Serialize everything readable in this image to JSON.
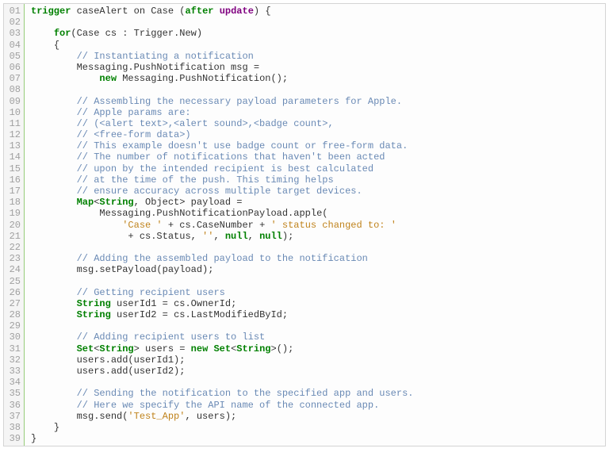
{
  "code": {
    "line_numbers": [
      "01",
      "02",
      "03",
      "04",
      "05",
      "06",
      "07",
      "08",
      "09",
      "10",
      "11",
      "12",
      "13",
      "14",
      "15",
      "16",
      "17",
      "18",
      "19",
      "20",
      "21",
      "22",
      "23",
      "24",
      "25",
      "26",
      "27",
      "28",
      "29",
      "30",
      "31",
      "32",
      "33",
      "34",
      "35",
      "36",
      "37",
      "38",
      "39"
    ],
    "tokens": {
      "trigger": "trigger",
      "for": "for",
      "new": "new",
      "after": "after",
      "update": "update",
      "null": "null",
      "Map": "Map",
      "String": "String",
      "Set": "Set"
    },
    "identifiers": {
      "caseAlert": "caseAlert",
      "on": "on",
      "Case": "Case",
      "cs": "cs",
      "Trigger_New": "Trigger.New",
      "Messaging_PushNotification": "Messaging.PushNotification",
      "msg": "msg",
      "Messaging_PushNotification_ctor": "Messaging.PushNotification();",
      "Object": "Object",
      "payload": "payload",
      "Messaging_PushNotificationPayload_apple": "Messaging.PushNotificationPayload.apple(",
      "cs_CaseNumber": "cs.CaseNumber",
      "cs_Status": "cs.Status",
      "msg_setPayload": "msg.setPayload(payload);",
      "userId1": "userId1",
      "userId2": "userId2",
      "cs_OwnerId": "cs.OwnerId;",
      "cs_LastModifiedById": "cs.LastModifiedById;",
      "users": "users",
      "users_add1": "users.add(userId1);",
      "users_add2": "users.add(userId2);",
      "msg_send": "msg.send("
    },
    "strings": {
      "case_prefix": "'Case '",
      "status_changed": "' status changed to: '",
      "empty": "''",
      "test_app": "'Test_App'"
    },
    "comments": {
      "c05": "// Instantiating a notification",
      "c09": "// Assembling the necessary payload parameters for Apple.",
      "c10": "// Apple params are:",
      "c11": "// (<alert text>,<alert sound>,<badge count>,",
      "c12": "// <free-form data>)",
      "c13": "// This example doesn't use badge count or free-form data.",
      "c14": "// The number of notifications that haven't been acted",
      "c15": "// upon by the intended recipient is best calculated",
      "c16": "// at the time of the push. This timing helps",
      "c17": "// ensure accuracy across multiple target devices.",
      "c23": "// Adding the assembled payload to the notification",
      "c26": "// Getting recipient users",
      "c30": "// Adding recipient users to list",
      "c35": "// Sending the notification to the specified app and users.",
      "c36": "// Here we specify the API name of the connected app."
    },
    "punct": {
      "open_brace": "{",
      "close_brace": "}",
      "open_paren": "(",
      "close_paren": ")",
      "colon": " : ",
      "lt": "<",
      "gt": ">",
      "comma": ", ",
      "eq": " = ",
      "plus": " + ",
      "semi": ");",
      "semi2": "();",
      "users_close": ", users);"
    }
  }
}
